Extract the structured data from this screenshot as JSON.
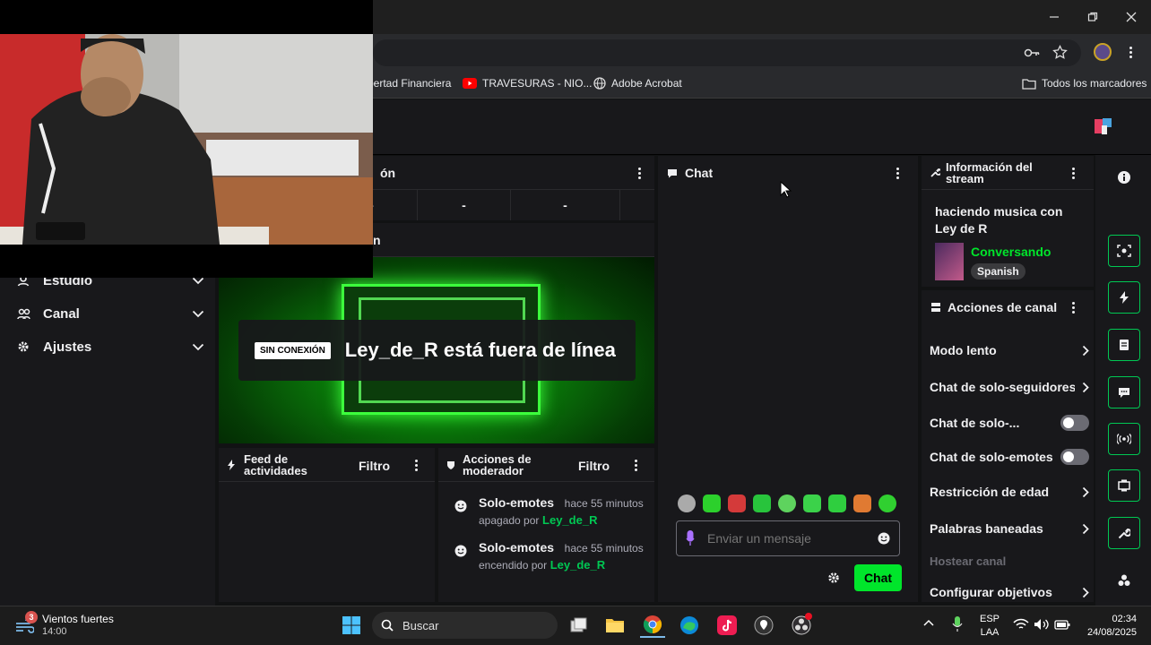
{
  "browser": {
    "bookmarks": [
      {
        "label": "bertad Financiera",
        "icon": "none"
      },
      {
        "label": "TRAVESURAS - NIO...",
        "icon": "youtube-icon"
      },
      {
        "label": "Adobe Acrobat",
        "icon": "globe-icon"
      }
    ],
    "all_bookmarks_label": "Todos los marcadores"
  },
  "nav": {
    "items": [
      {
        "label": "Estudio"
      },
      {
        "label": "Canal"
      },
      {
        "label": "Ajustes"
      }
    ]
  },
  "stats_panel": {
    "title_fragment": "ón",
    "cells": [
      "-",
      "-",
      "-"
    ]
  },
  "preview_panel": {
    "title_fragment": "n",
    "offline_tag": "SIN CONEXIÓN",
    "offline_text": "Ley_de_R está fuera de línea"
  },
  "activity_feed": {
    "title": "Feed de actividades",
    "filter_label": "Filtro"
  },
  "mod_actions": {
    "title": "Acciones de moderador",
    "filter_label": "Filtro",
    "entries": [
      {
        "action": "Solo-emotes",
        "time": "hace 55 minutos",
        "by_prefix": "apagado por",
        "user": "Ley_de_R"
      },
      {
        "action": "Solo-emotes",
        "time": "hace 55 minutos",
        "by_prefix": "encendido por",
        "user": "Ley_de_R"
      }
    ]
  },
  "chat": {
    "title": "Chat",
    "input_placeholder": "Enviar un mensaje",
    "button_label": "Chat"
  },
  "stream_info": {
    "title": "Información del stream",
    "stream_title": "haciendo musica con Ley de R",
    "category": "Conversando",
    "tag": "Spanish"
  },
  "channel_actions": {
    "title": "Acciones de canal",
    "rows": [
      {
        "label": "Modo lento",
        "control": "chevron"
      },
      {
        "label": "Chat de solo-seguidores",
        "control": "chevron"
      },
      {
        "label": "Chat de solo-...",
        "control": "toggle"
      },
      {
        "label": "Chat de solo-emotes",
        "control": "toggle"
      },
      {
        "label": "Restricción de edad",
        "control": "chevron"
      },
      {
        "label": "Palabras baneadas",
        "control": "chevron"
      },
      {
        "label": "Hostear canal",
        "control": "none"
      },
      {
        "label": "Configurar objetivos",
        "control": "chevron"
      }
    ]
  },
  "taskbar": {
    "weather_title": "Vientos fuertes",
    "weather_time": "14:00",
    "weather_badge": "3",
    "search_label": "Buscar",
    "lang_top": "ESP",
    "lang_bottom": "LAA",
    "clock_time": "02:34",
    "clock_date": "24/08/2025"
  },
  "colors": {
    "accent_green": "#00e52b",
    "username_green": "#00c853",
    "panel_bg": "#18181b",
    "page_bg": "#111213"
  }
}
